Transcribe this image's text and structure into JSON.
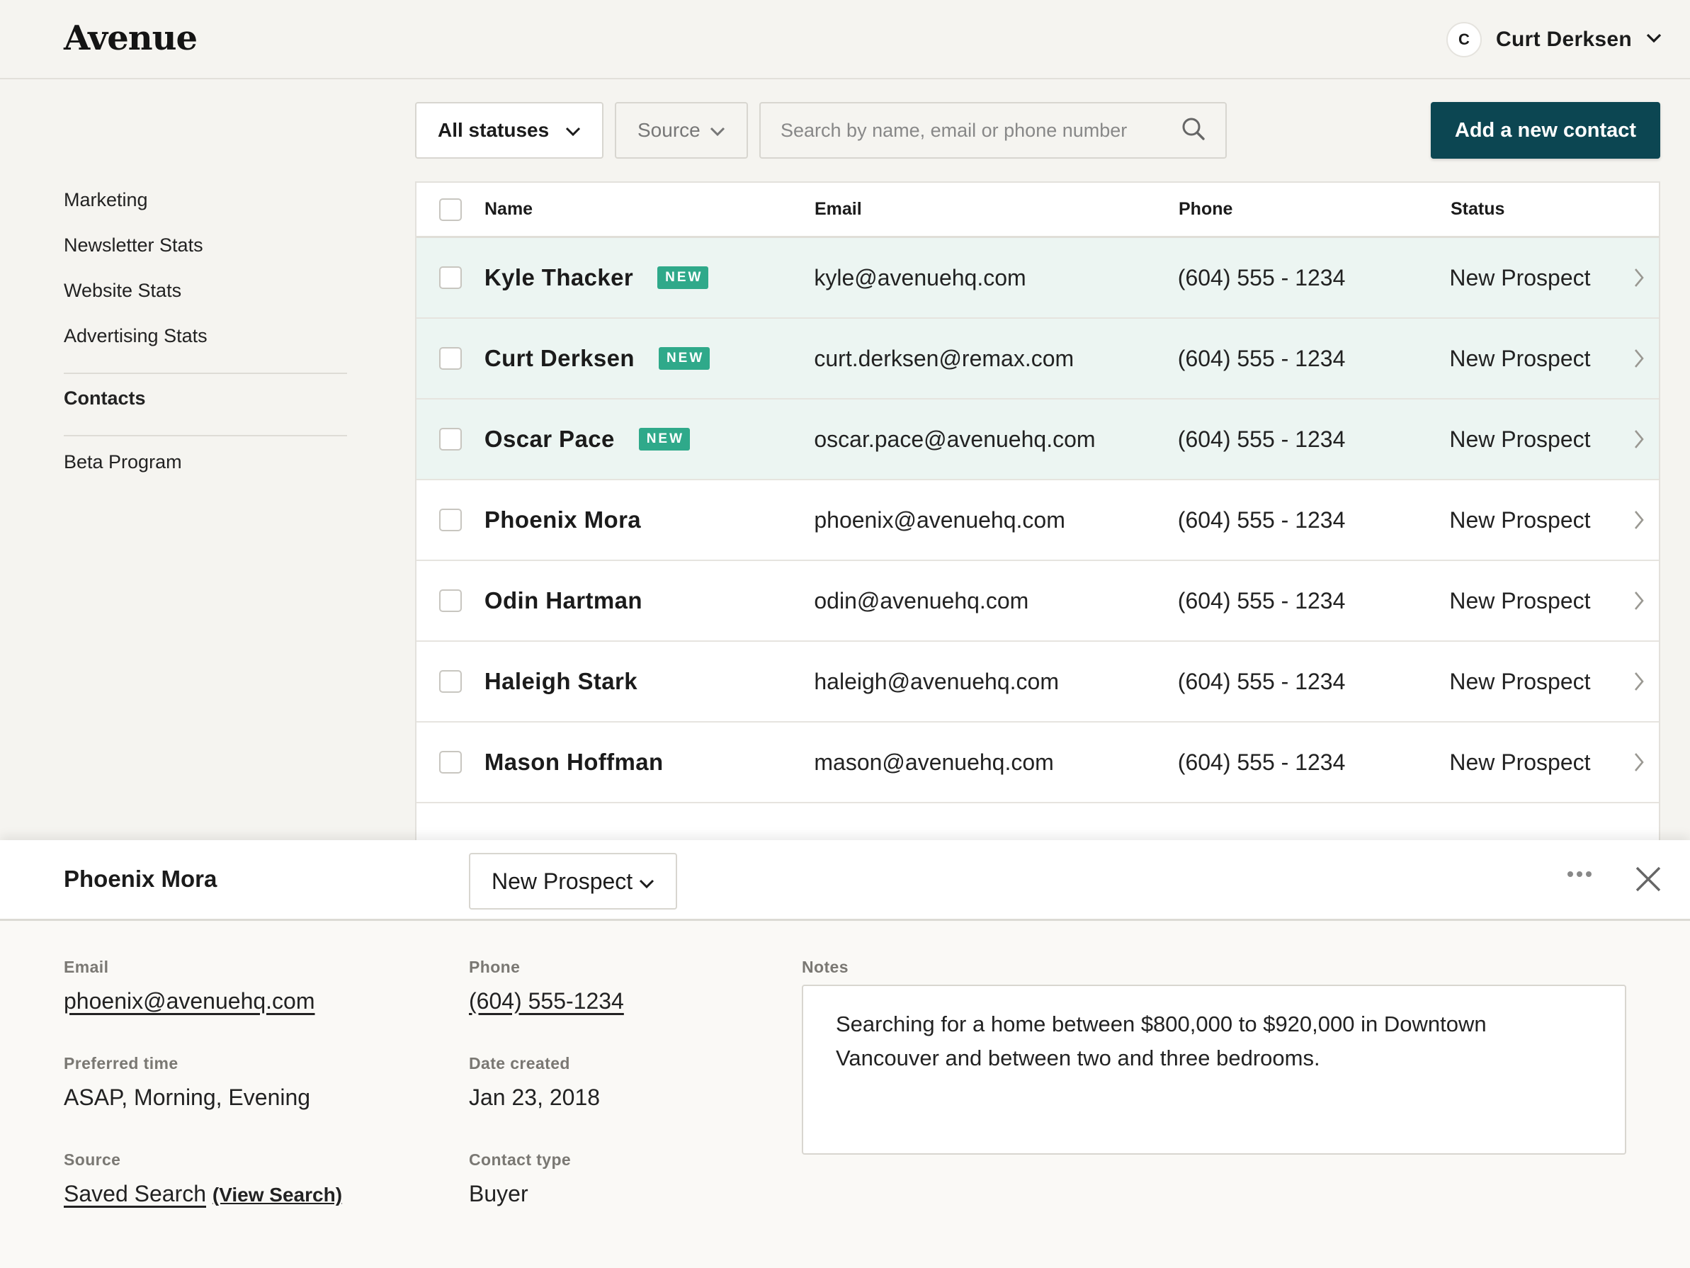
{
  "header": {
    "logo": "Avenue",
    "user": {
      "initial": "C",
      "name": "Curt Derksen"
    }
  },
  "sidebar": {
    "groups": [
      {
        "items": [
          {
            "label": "Marketing"
          },
          {
            "label": "Newsletter Stats"
          },
          {
            "label": "Website Stats"
          },
          {
            "label": "Advertising Stats"
          }
        ]
      },
      {
        "items": [
          {
            "label": "Contacts",
            "active": true
          }
        ]
      },
      {
        "items": [
          {
            "label": "Beta Program"
          }
        ]
      }
    ]
  },
  "toolbar": {
    "status_filter": "All statuses",
    "source_filter": "Source",
    "search_placeholder": "Search by name, email or phone number",
    "add_button": "Add a new contact"
  },
  "table": {
    "columns": [
      "Name",
      "Email",
      "Phone",
      "Status"
    ],
    "rows": [
      {
        "name": "Kyle Thacker",
        "badge": "NEW",
        "email": "kyle@avenuehq.com",
        "phone": "(604) 555 - 1234",
        "status": "New Prospect"
      },
      {
        "name": "Curt Derksen",
        "badge": "NEW",
        "email": "curt.derksen@remax.com",
        "phone": "(604) 555 - 1234",
        "status": "New Prospect"
      },
      {
        "name": "Oscar Pace",
        "badge": "NEW",
        "email": "oscar.pace@avenuehq.com",
        "phone": "(604) 555 - 1234",
        "status": "New Prospect"
      },
      {
        "name": "Phoenix Mora",
        "badge": "",
        "email": "phoenix@avenuehq.com",
        "phone": "(604) 555 - 1234",
        "status": "New Prospect"
      },
      {
        "name": "Odin Hartman",
        "badge": "",
        "email": "odin@avenuehq.com",
        "phone": "(604) 555 - 1234",
        "status": "New Prospect"
      },
      {
        "name": "Haleigh Stark",
        "badge": "",
        "email": "haleigh@avenuehq.com",
        "phone": "(604) 555 - 1234",
        "status": "New Prospect"
      },
      {
        "name": "Mason Hoffman",
        "badge": "",
        "email": "mason@avenuehq.com",
        "phone": "(604) 555 - 1234",
        "status": "New Prospect"
      }
    ]
  },
  "detail": {
    "name": "Phoenix Mora",
    "status": "New Prospect",
    "email_label": "Email",
    "email": "phoenix@avenuehq.com",
    "phone_label": "Phone",
    "phone": "(604) 555-1234",
    "preferred_time_label": "Preferred time",
    "preferred_time": "ASAP, Morning, Evening",
    "date_created_label": "Date created",
    "date_created": "Jan 23, 2018",
    "source_label": "Source",
    "source": "Saved Search",
    "view_search": "(View Search)",
    "contact_type_label": "Contact type",
    "contact_type": "Buyer",
    "notes_label": "Notes",
    "notes": "Searching for a home between $800,000 to $920,000 in Downtown Vancouver and between two and three bedrooms."
  },
  "colors": {
    "accent": "#0c4652",
    "badge": "#2fa98a",
    "new_row_bg": "#ecf5f2",
    "page_bg": "#f5f4f0"
  },
  "icons": [
    "chevron-down-icon",
    "search-icon",
    "chevron-right-icon",
    "more-icon",
    "close-icon"
  ]
}
